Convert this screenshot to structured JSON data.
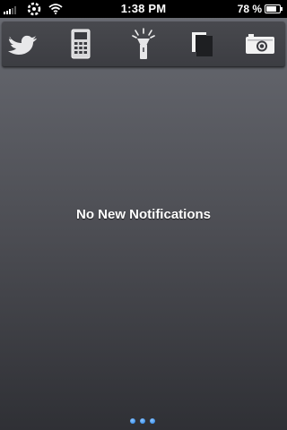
{
  "status_bar": {
    "time": "1:38 PM",
    "battery_percent": "78 %",
    "battery_level": 0.78,
    "icons": [
      "signal-bars-icon",
      "activity-spinner-icon",
      "wifi-icon",
      "battery-icon"
    ]
  },
  "toolbar": {
    "buttons": [
      {
        "name": "twitter",
        "icon": "twitter-bird-icon"
      },
      {
        "name": "phone",
        "icon": "phone-icon"
      },
      {
        "name": "flashlight",
        "icon": "flashlight-icon"
      },
      {
        "name": "clipboard",
        "icon": "clipboard-icon"
      },
      {
        "name": "camera",
        "icon": "camera-icon"
      }
    ]
  },
  "notifications": {
    "empty_message": "No New Notifications"
  },
  "pager": {
    "page_count": 3,
    "accent": "#2f8cf0"
  },
  "colors": {
    "status_bar": "#000000",
    "background_top": "#6e7077",
    "background_bottom": "#2f3035",
    "text": "#ffffff"
  }
}
